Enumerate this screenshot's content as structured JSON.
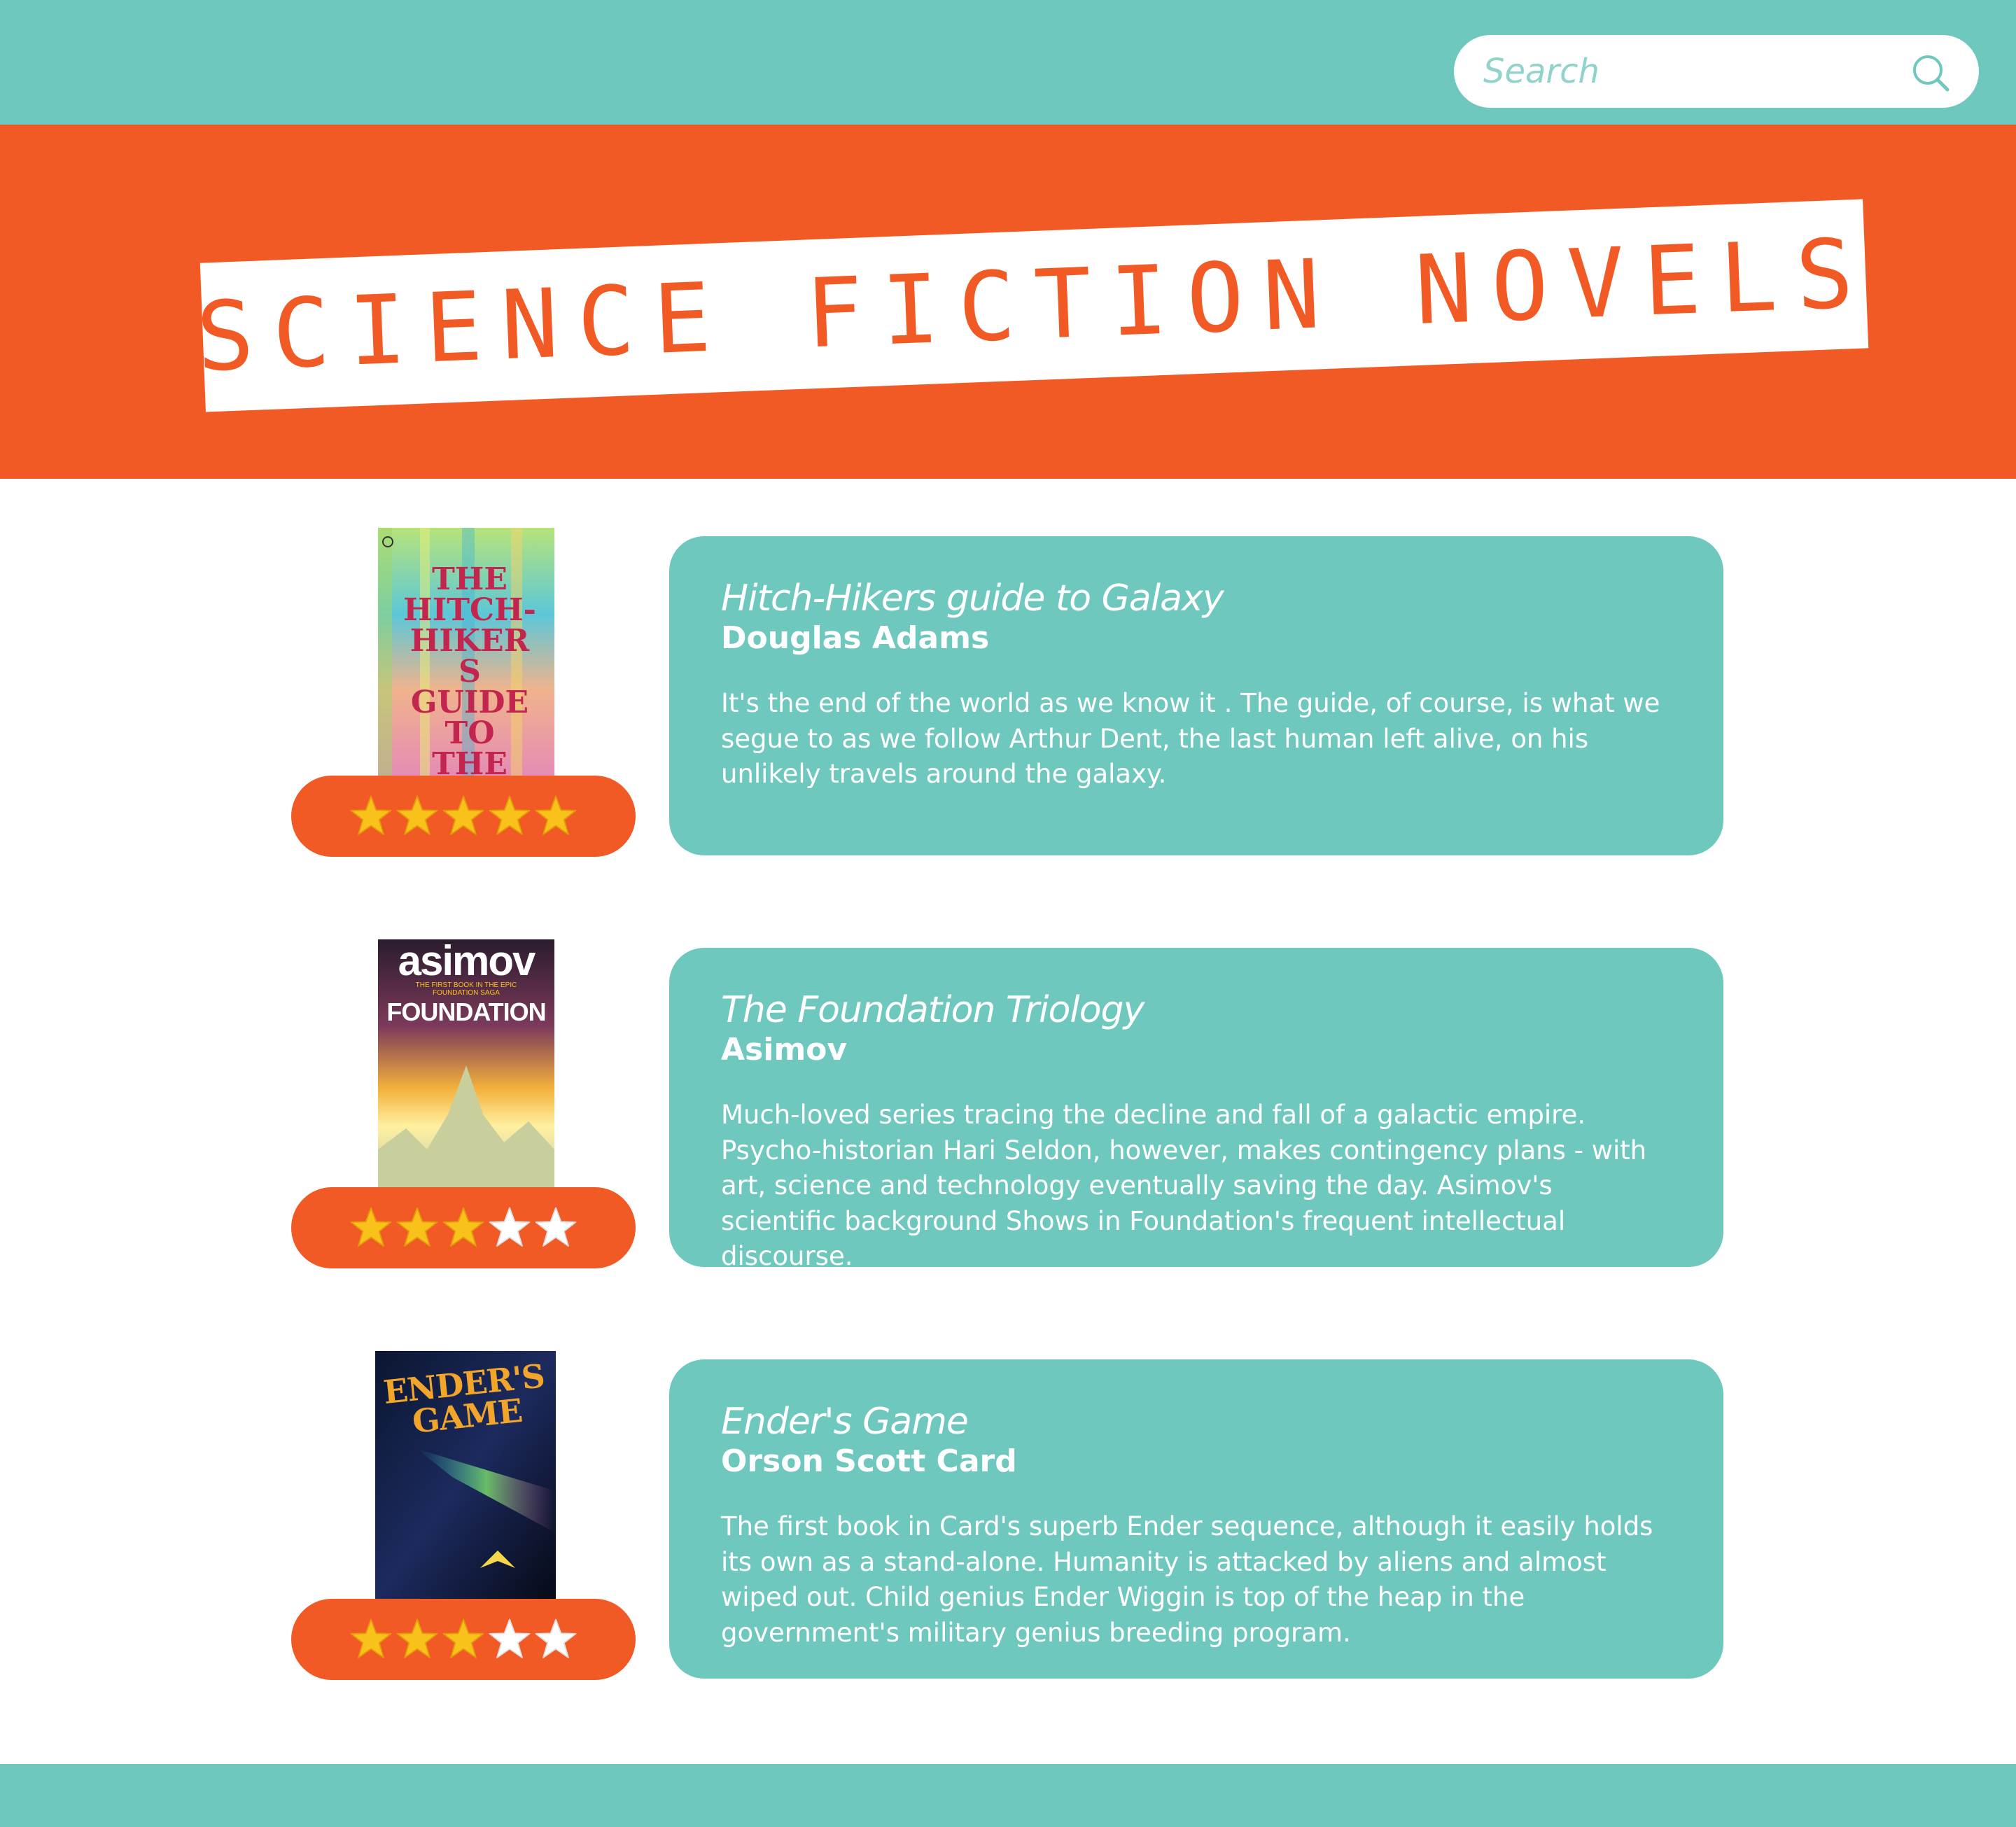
{
  "colors": {
    "teal": "#6ec8bd",
    "orange": "#f15a24",
    "white": "#ffffff",
    "star_gold": "#f9c21b"
  },
  "search": {
    "placeholder": "Search",
    "icon": "search-icon"
  },
  "header": {
    "title": "SCIENCE FICTION NOVELS"
  },
  "books": [
    {
      "title": "Hitch-Hikers guide to Galaxy",
      "author": "Douglas Adams",
      "description": "It's the end of the world as we know it . The guide, of course, is what we segue to as we follow Arthur Dent, the last human left alive, on his unlikely travels around the galaxy.",
      "rating": 5,
      "max_rating": 5,
      "cover_text": "THE HITCH-HIKERS GUIDE TO THE GALAXY"
    },
    {
      "title": "The Foundation Triology",
      "author": "Asimov",
      "description": "Much-loved series tracing the decline and fall of a galactic empire. Psycho-historian  Hari Seldon, however, makes contingency plans - with art, science and technology eventually saving the day. Asimov's scientific background Shows in Foundation's frequent intellectual discourse.",
      "rating": 3,
      "max_rating": 5,
      "cover_brand": "asimov",
      "cover_sub": "THE FIRST BOOK IN THE EPIC FOUNDATION SAGA",
      "cover_title": "FOUNDATION"
    },
    {
      "title": "Ender's Game",
      "author": "Orson Scott Card",
      "description": "The first book in Card's superb Ender sequence, although it easily holds its own as a stand-alone. Humanity is attacked by aliens and almost wiped out. Child genius Ender Wiggin is top of the heap in the government's military genius breeding program.",
      "rating": 3,
      "max_rating": 5,
      "cover_text": "ENDER'S GAME"
    }
  ]
}
